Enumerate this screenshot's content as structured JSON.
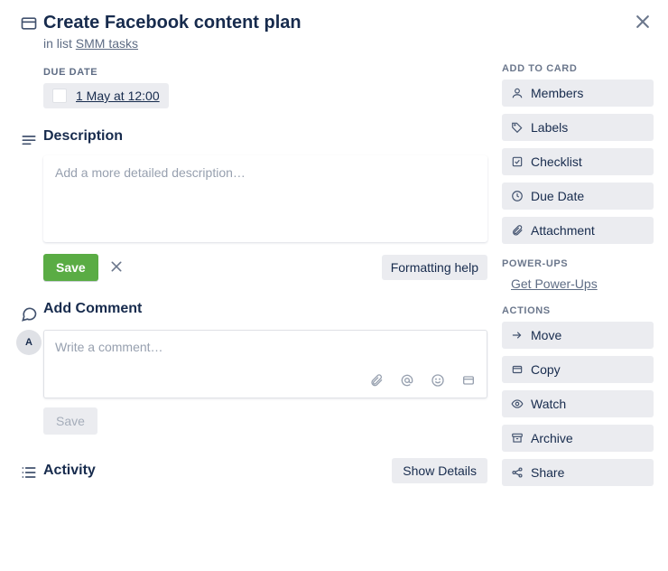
{
  "header": {
    "title": "Create Facebook content plan",
    "in_list_prefix": "in list ",
    "list_name": "SMM tasks"
  },
  "due": {
    "label": "DUE DATE",
    "value": "1 May at 12:00"
  },
  "description": {
    "heading": "Description",
    "placeholder": "Add a more detailed description…",
    "value": "",
    "save_label": "Save",
    "formatting_help_label": "Formatting help"
  },
  "comment": {
    "heading": "Add Comment",
    "placeholder": "Write a comment…",
    "value": "",
    "save_label": "Save",
    "avatar_initial": "A"
  },
  "activity": {
    "heading": "Activity",
    "show_details_label": "Show Details"
  },
  "sidebar": {
    "add_to_card_heading": "ADD TO CARD",
    "add_items": [
      {
        "label": "Members",
        "icon": "user-icon"
      },
      {
        "label": "Labels",
        "icon": "tag-icon"
      },
      {
        "label": "Checklist",
        "icon": "checklist-icon"
      },
      {
        "label": "Due Date",
        "icon": "clock-icon"
      },
      {
        "label": "Attachment",
        "icon": "paperclip-icon"
      }
    ],
    "powerups_heading": "POWER-UPS",
    "powerups_link": "Get Power-Ups",
    "actions_heading": "ACTIONS",
    "action_items": [
      {
        "label": "Move",
        "icon": "arrow-right-icon"
      },
      {
        "label": "Copy",
        "icon": "card-icon"
      },
      {
        "label": "Watch",
        "icon": "eye-icon"
      },
      {
        "label": "Archive",
        "icon": "archive-icon"
      },
      {
        "label": "Share",
        "icon": "share-icon"
      }
    ]
  }
}
